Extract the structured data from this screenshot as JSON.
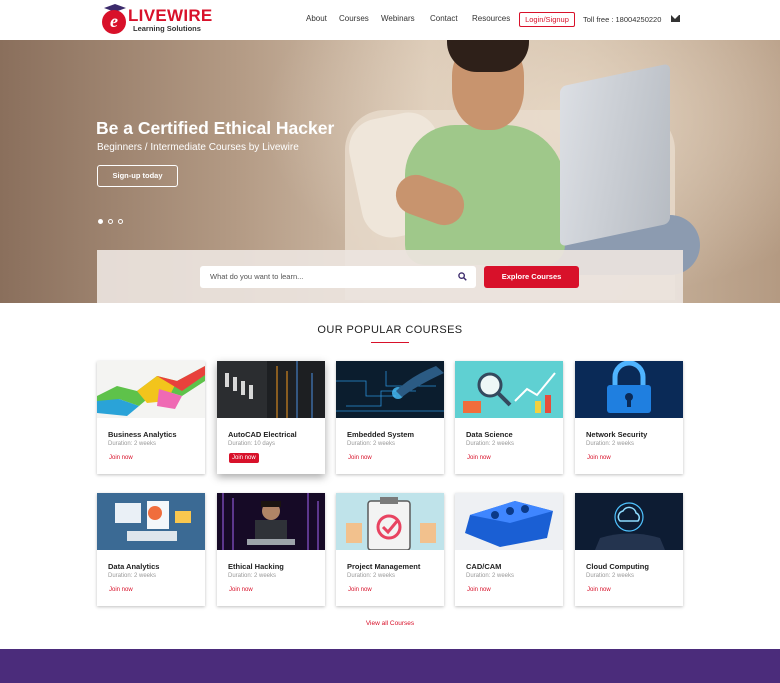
{
  "brand": {
    "initial": "e",
    "word": "LIVEWIRE",
    "sub": "Learning Solutions",
    "color": "#d8112a"
  },
  "nav": {
    "about": "About",
    "courses": "Courses",
    "webinars": "Webinars",
    "contact": "Contact",
    "resources": "Resources",
    "login": "Login/Signup",
    "tollfree": "Toll free : 18004250220"
  },
  "hero": {
    "title": "Be a Certified Ethical Hacker",
    "subtitle": "Beginners / Intermediate Courses by Livewire",
    "cta": "Sign-up today",
    "slides": 3,
    "active_slide": 1
  },
  "search": {
    "placeholder": "What do you want to learn...",
    "button": "Explore Courses"
  },
  "popular": {
    "title": "OUR POPULAR COURSES",
    "view_all": "View all Courses",
    "courses": [
      {
        "name": "Business Analytics",
        "duration": "Duration: 2 weeks",
        "join": "Join now",
        "image": "colorful-ribbon"
      },
      {
        "name": "AutoCAD Electrical",
        "duration": "Duration: 10 days",
        "join": "Join now",
        "image": "electrical-switches",
        "highlighted": true
      },
      {
        "name": "Embedded System",
        "duration": "Duration: 2 weeks",
        "join": "Join now",
        "image": "circuit-board"
      },
      {
        "name": "Data Science",
        "duration": "Duration: 2 weeks",
        "join": "Join now",
        "image": "magnifier-charts"
      },
      {
        "name": "Network Security",
        "duration": "Duration: 2 weeks",
        "join": "Join now",
        "image": "padlock"
      },
      {
        "name": "Data Analytics",
        "duration": "Duration: 2 weeks",
        "join": "Join now",
        "image": "analytics-devices"
      },
      {
        "name": "Ethical Hacking",
        "duration": "Duration: 2 weeks",
        "join": "Join now",
        "image": "hacker-laptop"
      },
      {
        "name": "Project Management",
        "duration": "Duration: 2 weeks",
        "join": "Join now",
        "image": "clipboard-check"
      },
      {
        "name": "CAD/CAM",
        "duration": "Duration: 2 weeks",
        "join": "Join now",
        "image": "engine-block"
      },
      {
        "name": "Cloud Computing",
        "duration": "Duration: 2 weeks",
        "join": "Join now",
        "image": "cloud-hand"
      }
    ]
  },
  "colors": {
    "accent": "#d8112a",
    "footer": "#4b2c7b"
  }
}
